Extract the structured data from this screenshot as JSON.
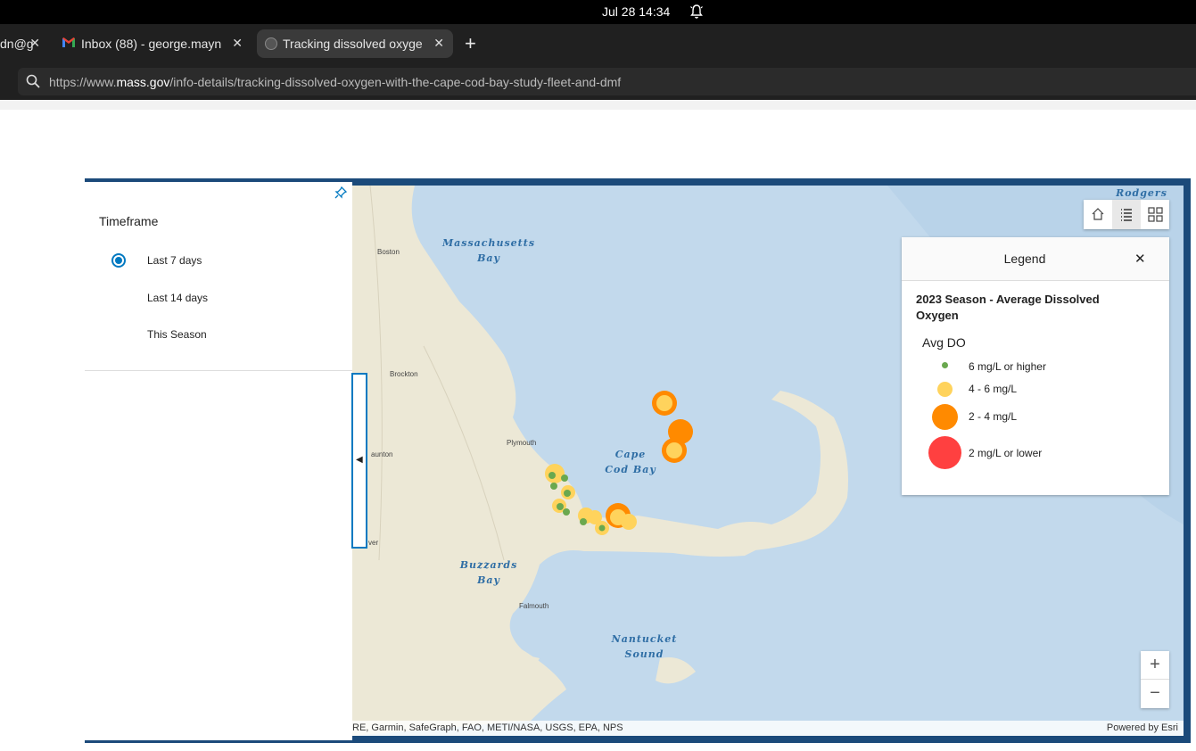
{
  "system": {
    "clock": "Jul 28  14:34"
  },
  "tabs": [
    {
      "title": "dn@g",
      "active": false
    },
    {
      "title": "Inbox (88) - george.mayn",
      "active": false
    },
    {
      "title": "Tracking dissolved oxyge",
      "active": true
    }
  ],
  "url": {
    "prefix": "https://www.",
    "domain": "mass.gov",
    "path": "/info-details/tracking-dissolved-oxygen-with-the-cape-cod-bay-study-fleet-and-dmf"
  },
  "panel": {
    "title": "Timeframe",
    "options": [
      "Last 7 days",
      "Last 14 days",
      "This Season"
    ],
    "selected": "Last 7 days"
  },
  "legend": {
    "title": "Legend",
    "layer": "2023 Season - Average Dissolved Oxygen",
    "field": "Avg DO",
    "classes": [
      {
        "label": "6 mg/L or higher",
        "color": "#6aa84f"
      },
      {
        "label": "4 - 6 mg/L",
        "color": "#ffd35c"
      },
      {
        "label": "2 - 4 mg/L",
        "color": "#ff8a00"
      },
      {
        "label": "2 mg/L or lower",
        "color": "#ff4040"
      }
    ]
  },
  "map": {
    "labels": {
      "mass_bay": "Massachusetts Bay",
      "cape_cod_bay": "Cape Cod Bay",
      "buzzards_bay": "Buzzards Bay",
      "nantucket_sound": "Nantucket Sound",
      "rodgers": "Rodgers"
    },
    "towns": [
      "Boston",
      "Brockton",
      "Plymouth",
      "aunton",
      "ver",
      "Falmouth"
    ],
    "attribution_left": "RE, Garmin, SafeGraph, FAO, METI/NASA, USGS, EPA, NPS",
    "attribution_right": "Powered by Esri"
  }
}
